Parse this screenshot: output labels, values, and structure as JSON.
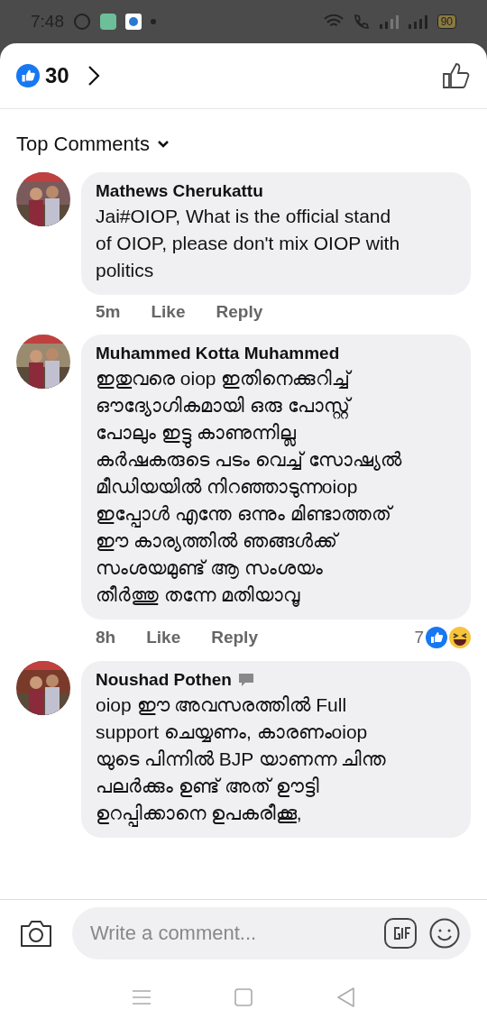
{
  "status_bar": {
    "time": "7:48",
    "battery": "90"
  },
  "header": {
    "like_count": "30"
  },
  "sort": {
    "label": "Top Comments"
  },
  "comments": [
    {
      "author": "Mathews Cherukattu",
      "badge": false,
      "body": "Jai#OIOP, What is the official stand\nof  OIOP, please don't mix OIOP with\npolitics",
      "time": "5m",
      "like": "Like",
      "reply": "Reply"
    },
    {
      "author": "Muhammed Kotta Muhammed",
      "badge": false,
      "body": "ഇതുവരെ oiop ഇതിനെക്കുറിച്ച്\nഔദ്യോഗികമായി ഒരു പോസ്റ്റ്\nപോലും ഇട്ടു കാണുന്നില്ല\nകർഷകരുടെ പടം വെച്ച് സോഷ്യൽ\nമീഡിയയിൽ നിറഞ്ഞാടുന്നoiop\nഇപ്പോൾ എന്തേ ഒന്നും മിണ്ടാത്തത്\nഈ കാര്യത്തിൽ ഞങ്ങൾക്ക്\nസംശയമുണ്ട് ആ സംശയം\nതീർത്തു തന്നേ മതിയാവൂ",
      "time": "8h",
      "like": "Like",
      "reply": "Reply",
      "reaction_count": "7"
    },
    {
      "author": "Noushad Pothen",
      "badge": true,
      "body": "oiop ഈ അവസരത്തിൽ Full\nsupport ചെയ്യണം, കാരണംoiop\nയുടെ പിന്നിൽ BJP യാണന്ന ചിന്ത\nപലർക്കും ഉണ്ട് അത് ഊട്ടി\nഉറപ്പിക്കാനെ ഉപകരീക്കൂ,"
    }
  ],
  "composer": {
    "placeholder": "Write a comment..."
  }
}
